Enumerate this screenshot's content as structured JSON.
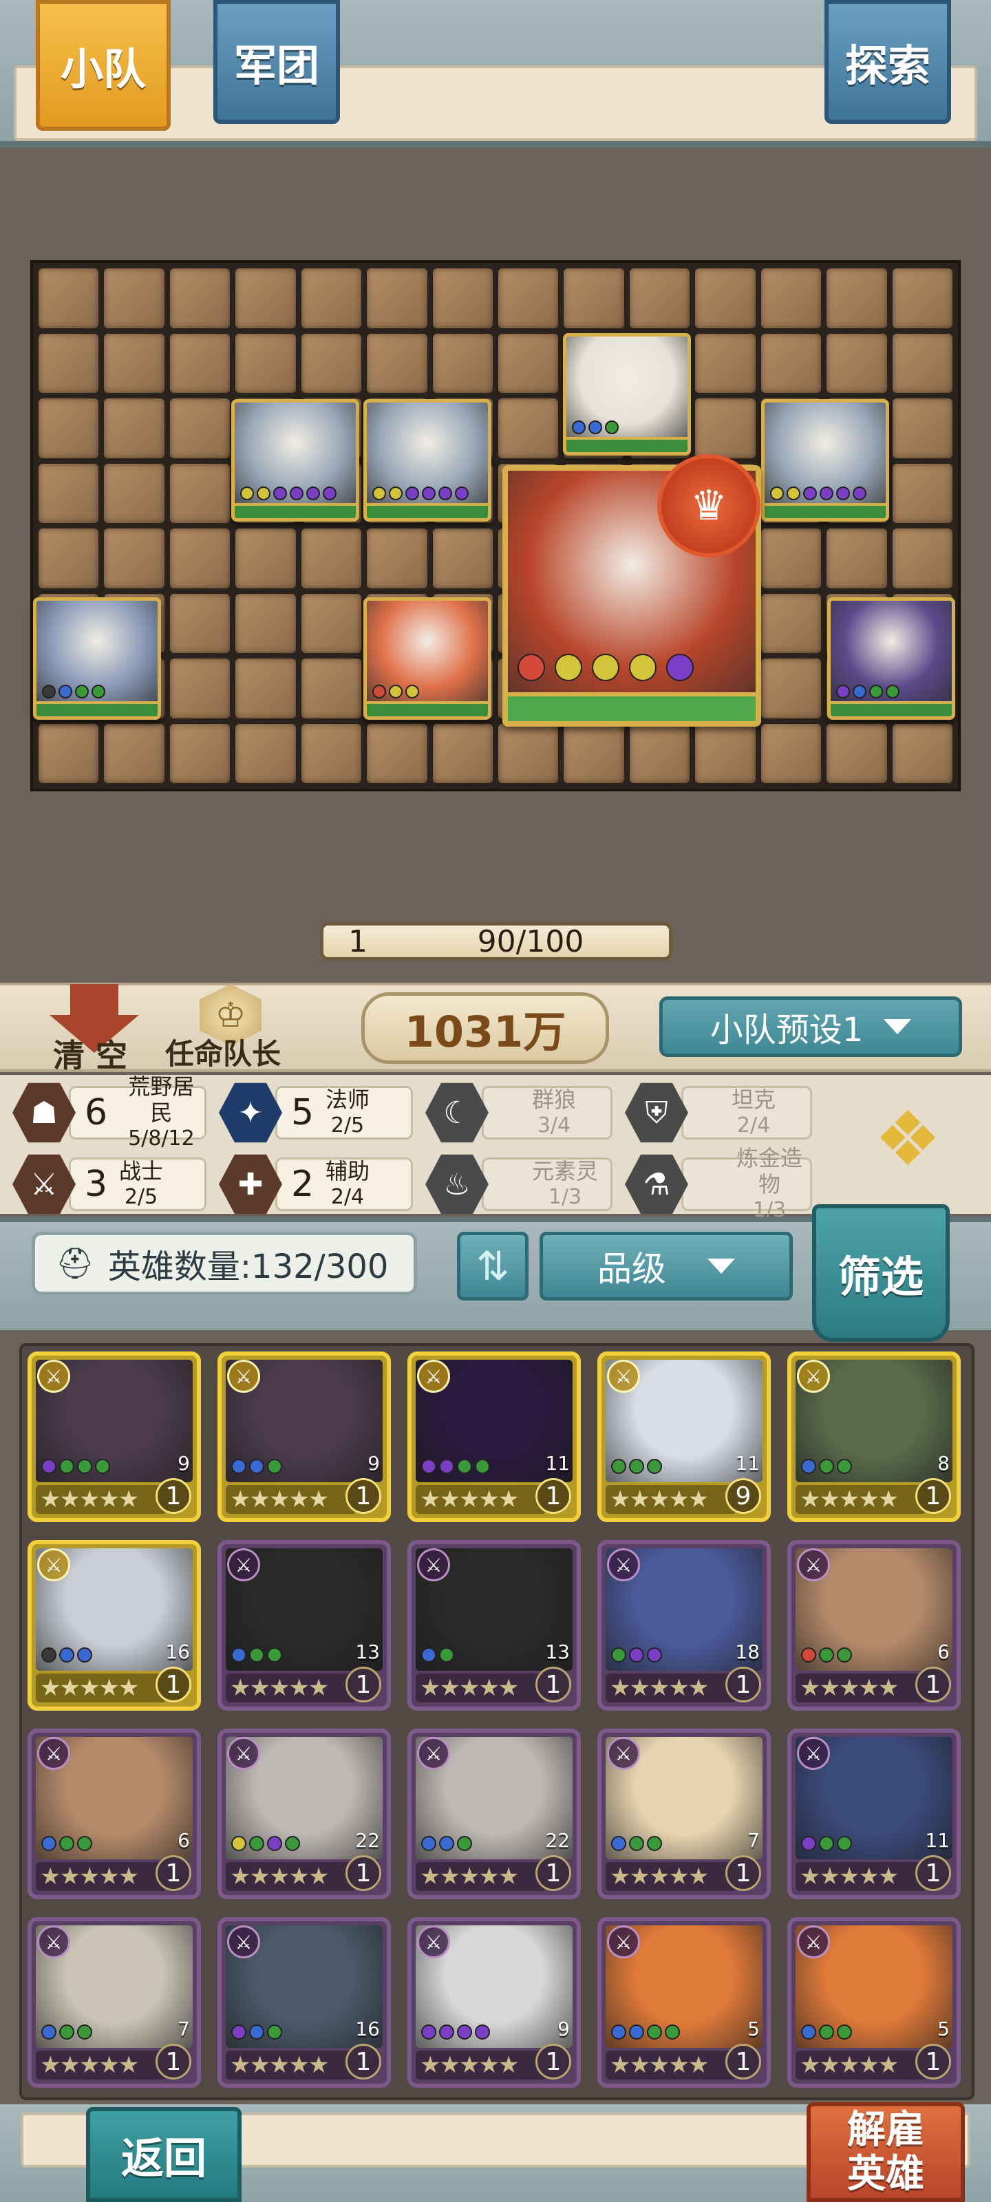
{
  "tabs": {
    "team": "小队",
    "legion": "军团",
    "explore": "探索"
  },
  "level_bar": {
    "level": "1",
    "xp": "90/100"
  },
  "actions": {
    "clear": "清 空",
    "appoint_captain": "任命队长",
    "power": "1031万",
    "preset": "小队预设1"
  },
  "synergies": [
    {
      "icon": "wilder-icon",
      "count": "6",
      "name": "荒野居民",
      "progress": "5/8/12",
      "active": true
    },
    {
      "icon": "mage-icon",
      "count": "5",
      "name": "法师",
      "progress": "2/5",
      "active": true
    },
    {
      "icon": "wolf-icon",
      "count": "",
      "name": "群狼",
      "progress": "3/4",
      "active": false
    },
    {
      "icon": "tank-icon",
      "count": "",
      "name": "坦克",
      "progress": "2/4",
      "active": false
    },
    {
      "icon": "warrior-icon",
      "count": "3",
      "name": "战士",
      "progress": "2/5",
      "active": true
    },
    {
      "icon": "support-icon",
      "count": "2",
      "name": "辅助",
      "progress": "2/4",
      "active": true
    },
    {
      "icon": "elemental-icon",
      "count": "",
      "name": "元素灵",
      "progress": "1/3",
      "active": false
    },
    {
      "icon": "alchemy-icon",
      "count": "",
      "name": "炼金造物",
      "progress": "1/3",
      "active": false
    }
  ],
  "roster": {
    "count_label": "英雄数量:132/300",
    "sort_label": "品级",
    "filter_label": "筛选"
  },
  "heroes": [
    {
      "rarity": "gold",
      "cost": "9",
      "level": "1",
      "art": "#4a3a4a",
      "dots": [
        "#7a3fc4",
        "#3a9a3a",
        "#3a9a3a",
        "#3a9a3a"
      ]
    },
    {
      "rarity": "gold",
      "cost": "9",
      "level": "1",
      "art": "#4a3a4a",
      "dots": [
        "#3a6ad4",
        "#3a6ad4",
        "#3a9a3a"
      ]
    },
    {
      "rarity": "gold",
      "cost": "11",
      "level": "1",
      "art": "#2a1a3e",
      "dots": [
        "#7a3fc4",
        "#7a3fc4",
        "#3a9a3a",
        "#3a9a3a"
      ]
    },
    {
      "rarity": "gold",
      "cost": "11",
      "level": "9",
      "art": "#d8dde6",
      "dots": [
        "#3a9a3a",
        "#3a9a3a",
        "#3a9a3a"
      ]
    },
    {
      "rarity": "gold",
      "cost": "8",
      "level": "1",
      "art": "#5a6a4a",
      "dots": [
        "#3a6ad4",
        "#3a9a3a",
        "#3a9a3a"
      ]
    },
    {
      "rarity": "gold",
      "cost": "16",
      "level": "1",
      "art": "#c9ced6",
      "dots": [
        "#3a3a3a",
        "#3a6ad4",
        "#3a6ad4"
      ]
    },
    {
      "rarity": "purple",
      "cost": "13",
      "level": "1",
      "art": "#2a2a2a",
      "dots": [
        "#3a6ad4",
        "#3a9a3a",
        "#3a9a3a"
      ]
    },
    {
      "rarity": "purple",
      "cost": "13",
      "level": "1",
      "art": "#2a2a2a",
      "dots": [
        "#3a6ad4",
        "#3a9a3a"
      ]
    },
    {
      "rarity": "purple",
      "cost": "18",
      "level": "1",
      "art": "#4a5a9a",
      "dots": [
        "#3a9a3a",
        "#7a3fc4",
        "#7a3fc4"
      ]
    },
    {
      "rarity": "purple",
      "cost": "6",
      "level": "1",
      "art": "#b58a6a",
      "dots": [
        "#d44a3a",
        "#3a9a3a",
        "#3a9a3a"
      ]
    },
    {
      "rarity": "purple",
      "cost": "6",
      "level": "1",
      "art": "#b58a6a",
      "dots": [
        "#3a6ad4",
        "#3a9a3a",
        "#3a9a3a"
      ]
    },
    {
      "rarity": "purple",
      "cost": "22",
      "level": "1",
      "art": "#bdb8b4",
      "dots": [
        "#d4c43a",
        "#3a9a3a",
        "#7a3fc4",
        "#3a9a3a"
      ]
    },
    {
      "rarity": "purple",
      "cost": "22",
      "level": "1",
      "art": "#bdb8b4",
      "dots": [
        "#3a6ad4",
        "#3a6ad4",
        "#3a9a3a"
      ]
    },
    {
      "rarity": "purple",
      "cost": "7",
      "level": "1",
      "art": "#e8d4b0",
      "dots": [
        "#3a6ad4",
        "#3a9a3a",
        "#3a9a3a"
      ]
    },
    {
      "rarity": "purple",
      "cost": "11",
      "level": "1",
      "art": "#3a4a7a",
      "dots": [
        "#7a3fc4",
        "#3a9a3a",
        "#3a9a3a"
      ]
    },
    {
      "rarity": "purple",
      "cost": "7",
      "level": "1",
      "art": "#c9c4b4",
      "dots": [
        "#3a6ad4",
        "#3a9a3a",
        "#3a9a3a"
      ]
    },
    {
      "rarity": "purple",
      "cost": "16",
      "level": "1",
      "art": "#4a5a6a",
      "dots": [
        "#7a3fc4",
        "#3a6ad4",
        "#3a9a3a"
      ]
    },
    {
      "rarity": "purple",
      "cost": "9",
      "level": "1",
      "art": "#d8d8d8",
      "dots": [
        "#7a3fc4",
        "#7a3fc4",
        "#7a3fc4",
        "#7a3fc4"
      ]
    },
    {
      "rarity": "purple",
      "cost": "5",
      "level": "1",
      "art": "#e07a3a",
      "dots": [
        "#3a6ad4",
        "#3a6ad4",
        "#3a9a3a",
        "#3a9a3a"
      ]
    },
    {
      "rarity": "purple",
      "cost": "5",
      "level": "1",
      "art": "#e07a3a",
      "dots": [
        "#3a6ad4",
        "#3a9a3a",
        "#3a9a3a"
      ]
    }
  ],
  "board_units": [
    {
      "name": "wolf-1",
      "art": "#9aa8b8",
      "dots": [
        "#d4c43a",
        "#d4c43a",
        "#7a3fc4",
        "#7a3fc4",
        "#7a3fc4",
        "#7a3fc4"
      ]
    },
    {
      "name": "wolf-2",
      "art": "#9aa8b8",
      "dots": [
        "#d4c43a",
        "#d4c43a",
        "#7a3fc4",
        "#7a3fc4",
        "#7a3fc4",
        "#7a3fc4"
      ]
    },
    {
      "name": "wizard",
      "art": "#e6e2d8",
      "dots": [
        "#3a6ad4",
        "#3a6ad4",
        "#3a9a3a"
      ]
    },
    {
      "name": "wolf-3",
      "art": "#9aa8b8",
      "dots": [
        "#d4c43a",
        "#d4c43a",
        "#7a3fc4",
        "#7a3fc4",
        "#7a3fc4",
        "#7a3fc4"
      ]
    },
    {
      "name": "frog-sage",
      "art": "#8a9ab8",
      "dots": [
        "#3a3a3a",
        "#3a6ad4",
        "#3a9a3a",
        "#3a9a3a"
      ]
    },
    {
      "name": "fire-dragon",
      "art": "#e0704a",
      "dots": [
        "#d44a3a",
        "#d4c43a",
        "#d4c43a"
      ]
    },
    {
      "name": "spirit-mage",
      "art": "#5a4a8a",
      "dots": [
        "#7a3fc4",
        "#3a6ad4",
        "#3a9a3a",
        "#3a9a3a"
      ]
    },
    {
      "name": "fire-bear",
      "art": "#b8452a",
      "dots": [
        "#d44a3a",
        "#d4c43a",
        "#d4c43a",
        "#d4c43a",
        "#7a3fc4"
      ]
    }
  ],
  "bottom": {
    "back": "返回",
    "dismiss": "解雇英雄"
  }
}
